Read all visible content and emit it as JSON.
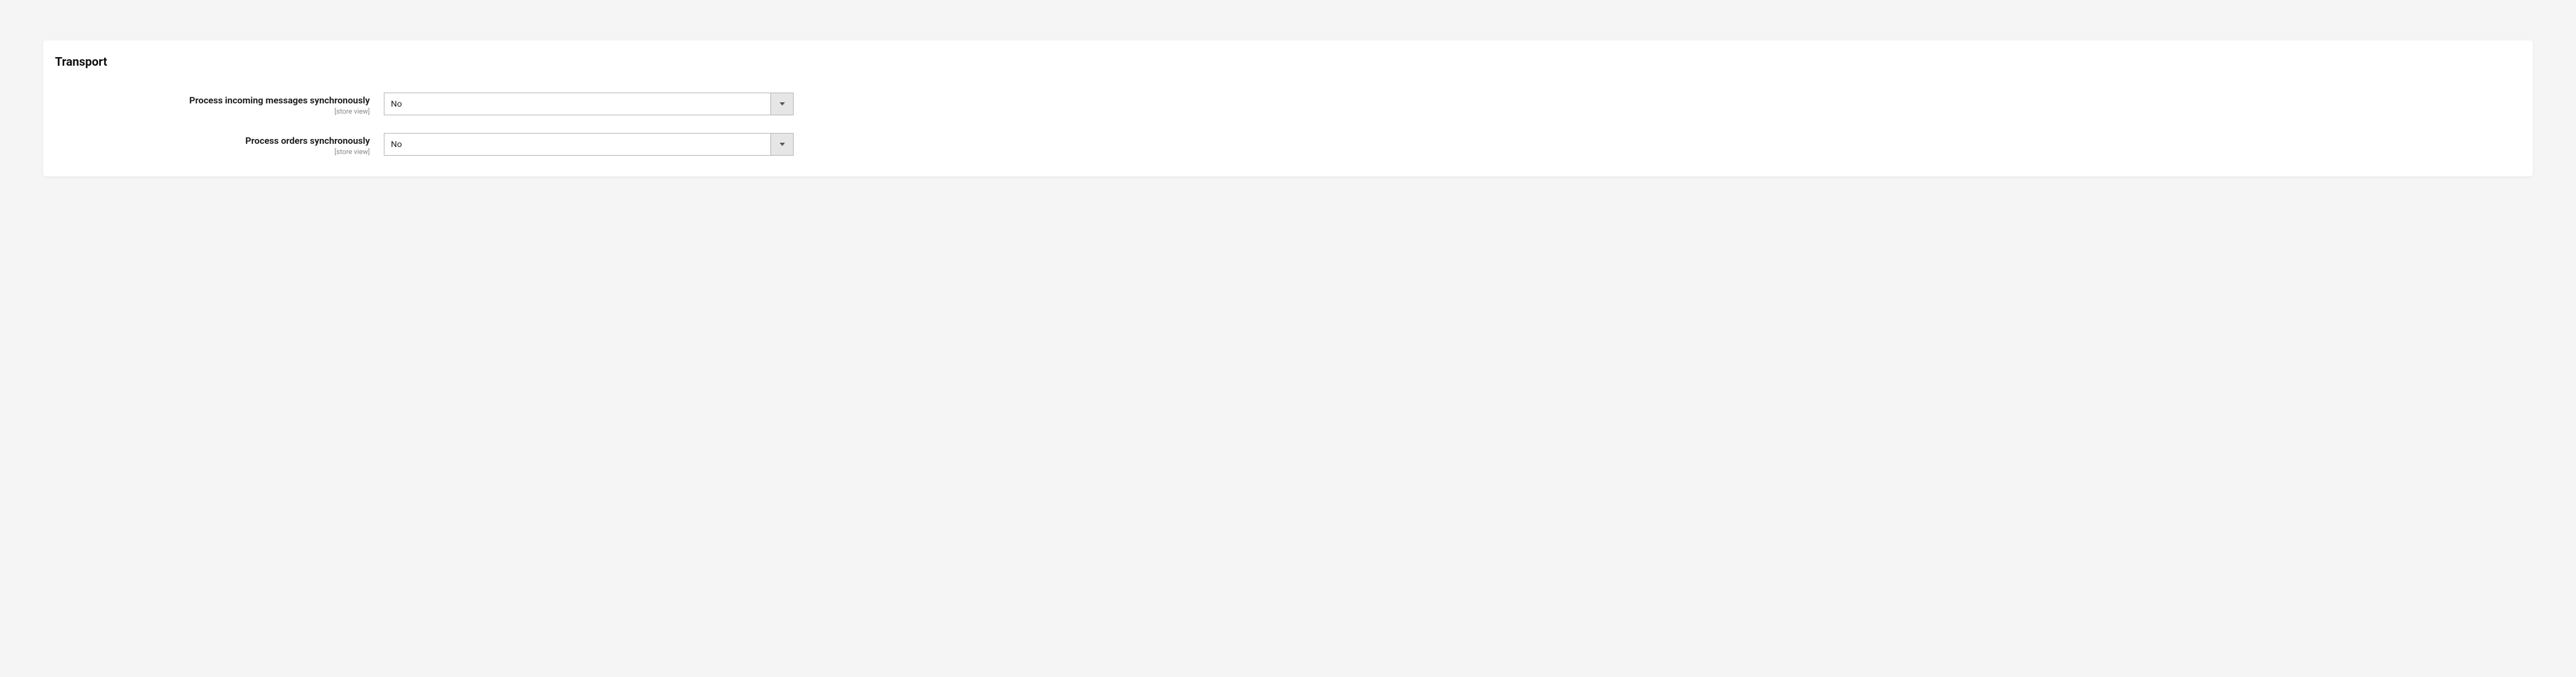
{
  "section": {
    "title": "Transport"
  },
  "fields": [
    {
      "label": "Process incoming messages synchronously",
      "scope": "[store view]",
      "value": "No"
    },
    {
      "label": "Process orders synchronously",
      "scope": "[store view]",
      "value": "No"
    }
  ]
}
